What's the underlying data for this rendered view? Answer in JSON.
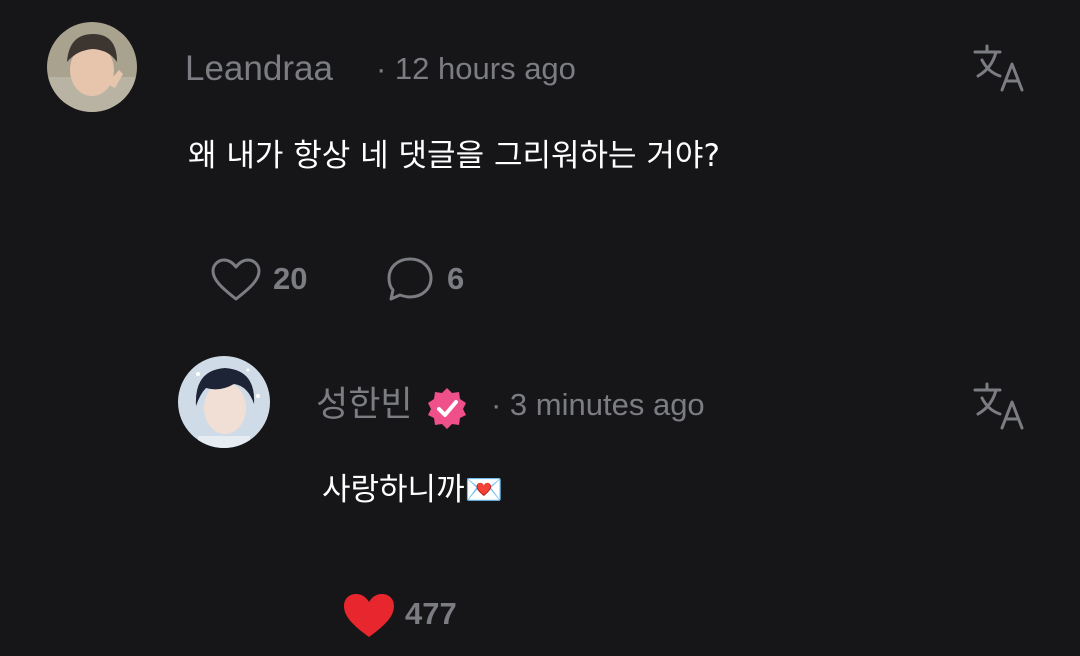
{
  "comment": {
    "username": "Leandraa",
    "time": "· 12 hours ago",
    "text": "왜 내가 항상 네 댓글을 그리워하는 거야?",
    "likes": "20",
    "replies": "6",
    "liked": false
  },
  "reply": {
    "username": "성한빈",
    "verified": true,
    "time": "· 3 minutes ago",
    "text": "사랑하니까",
    "emoji": "💌",
    "likes": "477",
    "liked": true
  },
  "colors": {
    "background": "#161618",
    "muted_text": "#7b7d82",
    "like_red": "#e8262e",
    "verified_pink": "#f0508a"
  },
  "icons": {
    "translate": "translate-icon",
    "heart": "heart-outline-icon",
    "heart_filled": "heart-filled-icon",
    "comment": "speech-bubble-icon",
    "verified": "verified-badge-icon"
  }
}
